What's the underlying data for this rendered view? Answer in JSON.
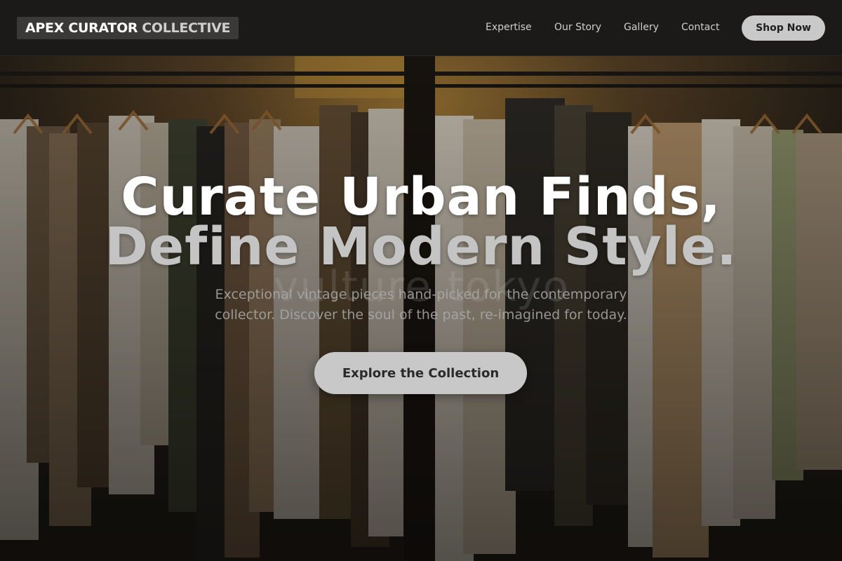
{
  "brand": {
    "name_part1": "APEX CURATOR",
    "name_part2": "COLLECTIVE"
  },
  "nav": {
    "items": [
      "Expertise",
      "Our Story",
      "Gallery",
      "Contact"
    ],
    "cta_label": "Shop Now"
  },
  "hero": {
    "headline_line1": "Curate Urban Finds,",
    "headline_line2": "Define Modern Style.",
    "background_word": "vulture tokyo",
    "subtitle": "Exceptional vintage pieces hand-picked for the contemporary collector. Discover the soul of the past, re-imagined for today.",
    "cta_label": "Explore the Collection"
  },
  "colors": {
    "header_bg": "#1b1a19",
    "button_bg": "#c8c8c8",
    "headline_primary": "#ffffff",
    "headline_secondary": "#c4c4c4"
  }
}
